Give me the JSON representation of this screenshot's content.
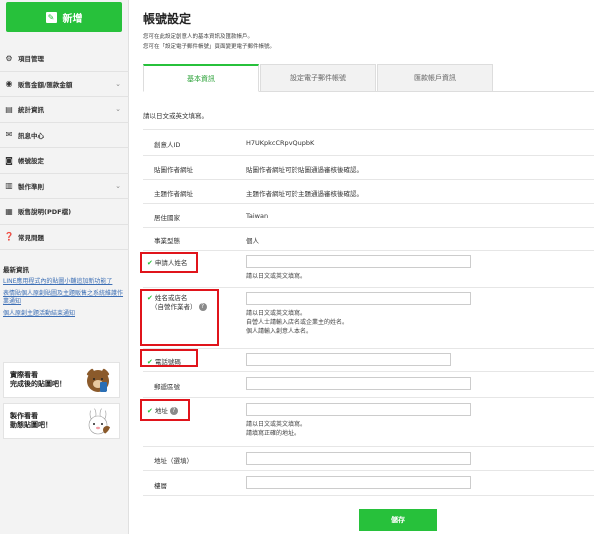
{
  "sidebar": {
    "new_button": "新增",
    "menu": [
      {
        "label": "項目管理",
        "icon": "gear-icon",
        "expandable": false
      },
      {
        "label": "販售金額/匯款金額",
        "icon": "coins-icon",
        "expandable": true
      },
      {
        "label": "統計資訊",
        "icon": "chart-icon",
        "expandable": true
      },
      {
        "label": "訊息中心",
        "icon": "mail-icon",
        "expandable": false
      },
      {
        "label": "帳號設定",
        "icon": "user-icon",
        "expandable": false
      },
      {
        "label": "製作準則",
        "icon": "book-icon",
        "expandable": true
      },
      {
        "label": "販售說明(PDF檔)",
        "icon": "document-icon",
        "expandable": false
      },
      {
        "label": "常見問題",
        "icon": "help-icon",
        "expandable": false
      }
    ],
    "news_title": "最新資訊",
    "news_links": [
      "LINE應用程式內的貼圖小舖追加新功能了",
      "表情貼個人原創貼圖及主題販售之系統維護作業通知",
      "個人原創主題活動結束通知"
    ],
    "promo1": "實際看看\n完成後的貼圖吧！",
    "promo2": "製作看看\n動態貼圖吧！"
  },
  "main": {
    "title": "帳號設定",
    "subtitle1": "您可在此設定創意人的基本資訊及匯款帳戶。",
    "subtitle2": "您可在「設定電子郵件帳號」頁面變更電子郵件帳號。",
    "tabs": [
      "基本資訊",
      "設定電子郵件帳號",
      "匯款帳戶資訊"
    ],
    "instruction": "請以日文或英文填寫。",
    "fields": {
      "creator_id_label": "創意人ID",
      "creator_id_value": "H7UKpkcCRpvQupbK",
      "sticker_url_label": "貼圖作者網址",
      "sticker_url_value": "貼圖作者網址可於貼圖通過審核後確認。",
      "theme_url_label": "主題作者網址",
      "theme_url_value": "主題作者網址可於主題通過審核後確認。",
      "country_label": "居住國家",
      "country_value": "Taiwan",
      "business_label": "事業型態",
      "business_value": "個人",
      "applicant_label": "申請人姓名",
      "applicant_note": "請以日文或英文填寫。",
      "name_label": "姓名或店名",
      "name_label_sub": "（自營作業者）",
      "name_notes": [
        "請以日文或英文填寫。",
        "自營人士請輸入店名或企業主的姓名。",
        "個人請輸入創意人本名。"
      ],
      "phone_label": "電話號碼",
      "postal_label": "郵遞區號",
      "address_label": "地址",
      "address_notes": [
        "請以日文或英文填寫。",
        "請填寫正確的地址。"
      ],
      "address_opt_label": "地址（選填）",
      "building_label": "樓層"
    },
    "save_button": "儲存"
  },
  "colors": {
    "accent": "#27c13b",
    "highlight": "#e0141b",
    "link": "#3d6fb5"
  }
}
